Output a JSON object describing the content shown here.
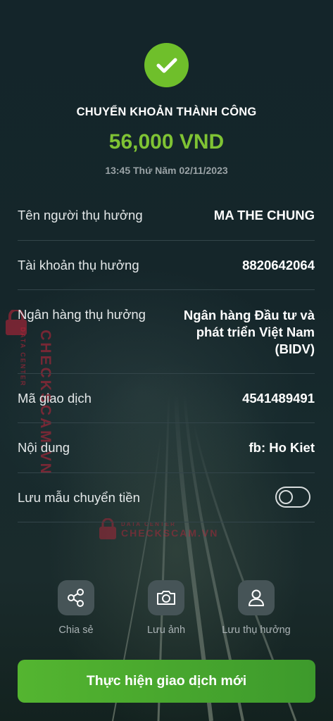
{
  "header": {
    "status": "CHUYỂN KHOẢN THÀNH CÔNG",
    "amount": "56,000 VND",
    "datetime": "13:45 Thứ Năm 02/11/2023"
  },
  "details": [
    {
      "label": "Tên người thụ hưởng",
      "value": "MA THE CHUNG"
    },
    {
      "label": "Tài khoản thụ hưởng",
      "value": "8820642064"
    },
    {
      "label": "Ngân hàng thụ hưởng",
      "value_lines": [
        "Ngân hàng Đầu tư và",
        "phát triển Việt Nam",
        "(BIDV)"
      ]
    },
    {
      "label": "Mã giao dịch",
      "value": "4541489491"
    },
    {
      "label": "Nội dung",
      "value": "fb: Ho Kiet"
    }
  ],
  "save_template": {
    "label": "Lưu mẫu chuyển tiền",
    "enabled": false
  },
  "actions": [
    {
      "label": "Chia sẻ",
      "icon": "share-icon"
    },
    {
      "label": "Lưu ảnh",
      "icon": "camera-icon"
    },
    {
      "label": "Lưu thụ hưởng",
      "icon": "user-icon"
    }
  ],
  "primary_button": "Thực hiện giao dịch mới",
  "watermark": {
    "brand": "CHECKSCAM.VN",
    "tagline": "DATA CENTER"
  },
  "colors": {
    "accent_green": "#6fbf2b",
    "amount_green": "#7fc334",
    "watermark_red": "#c3243a"
  }
}
